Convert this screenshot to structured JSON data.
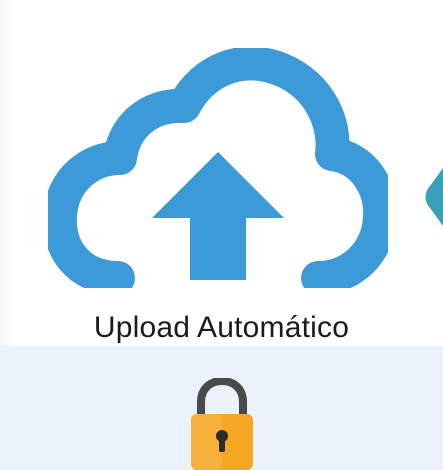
{
  "feature": {
    "caption": "Upload Automático",
    "icon": "cloud-upload-icon",
    "next_icon": "lock-icon"
  },
  "colors": {
    "cloud": "#3d9ad9",
    "arrow_side": "#3aa0b8",
    "lock_body": "#f5a623",
    "lock_shackle": "#4a4a4a",
    "panel_bottom": "#eaf3fb"
  }
}
